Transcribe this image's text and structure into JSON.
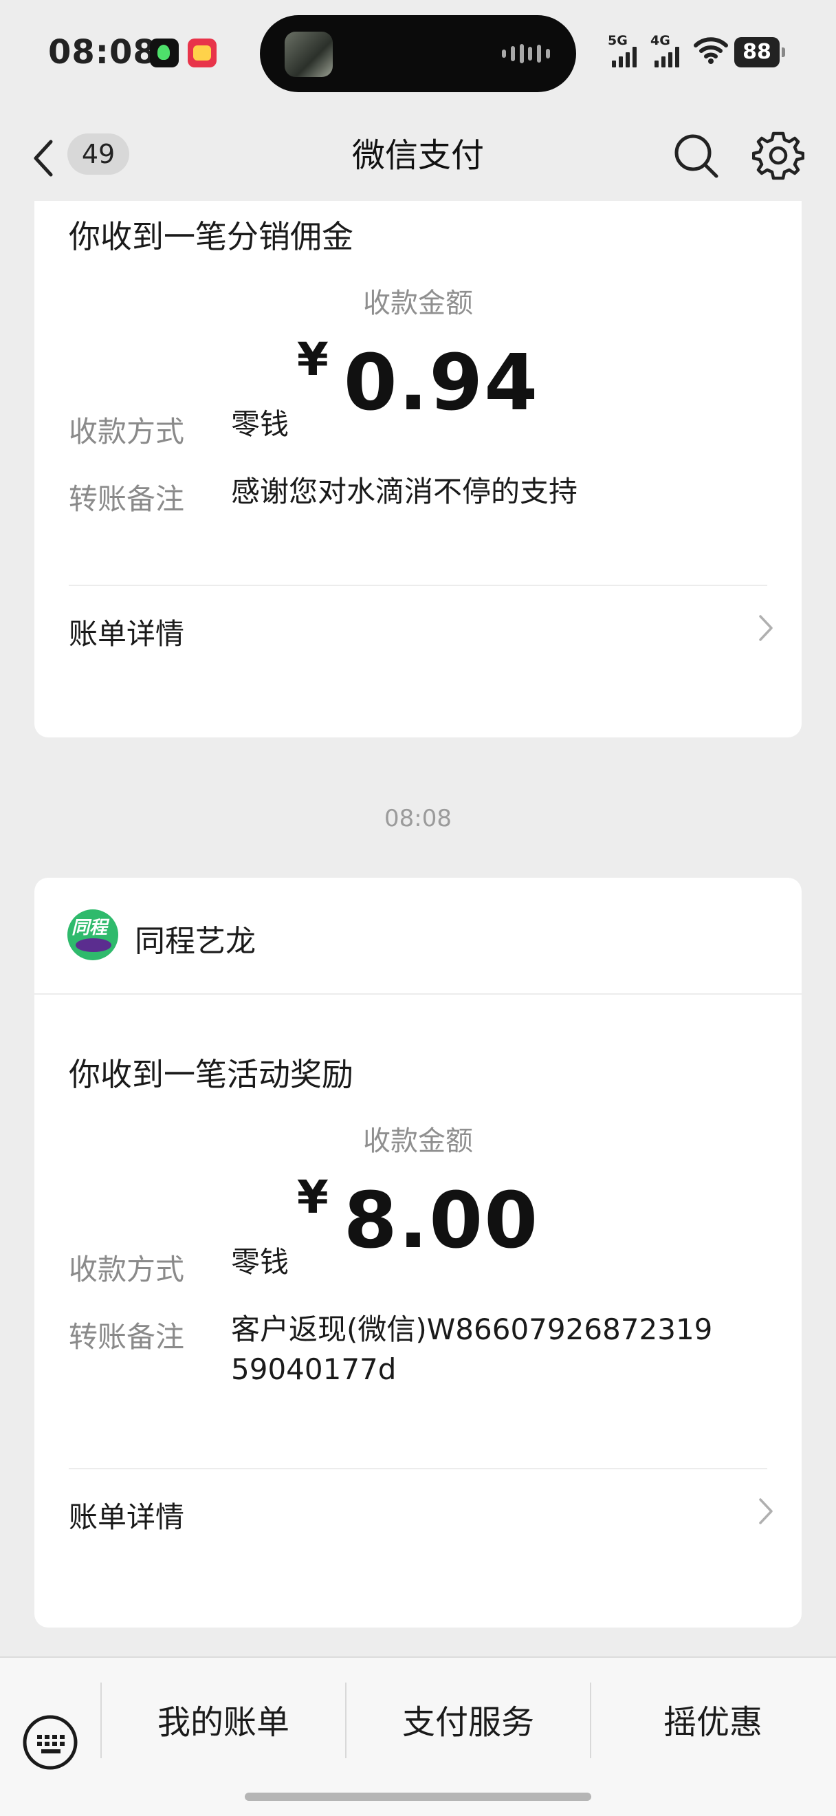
{
  "status_bar": {
    "time": "08:08",
    "signal_1_label": "5G",
    "signal_2_label": "4G",
    "battery": "88"
  },
  "nav": {
    "unread_count": "49",
    "title": "微信支付"
  },
  "messages": [
    {
      "heading": "你收到一笔分销佣金",
      "amount_label": "收款金额",
      "currency": "¥",
      "amount": "0.94",
      "method_label": "收款方式",
      "method_value": "零钱",
      "note_label": "转账备注",
      "note_value": "感谢您对水滴消不停的支持",
      "detail_label": "账单详情"
    },
    {
      "timestamp": "08:08",
      "merchant": "同程艺龙",
      "merchant_logo_text": "同程",
      "heading": "你收到一笔活动奖励",
      "amount_label": "收款金额",
      "currency": "¥",
      "amount": "8.00",
      "method_label": "收款方式",
      "method_value": "零钱",
      "note_label": "转账备注",
      "note_value": "客户返现(微信)W8660792687231959040177d",
      "detail_label": "账单详情"
    }
  ],
  "bottom_menu": {
    "items": [
      "我的账单",
      "支付服务",
      "摇优惠"
    ]
  }
}
